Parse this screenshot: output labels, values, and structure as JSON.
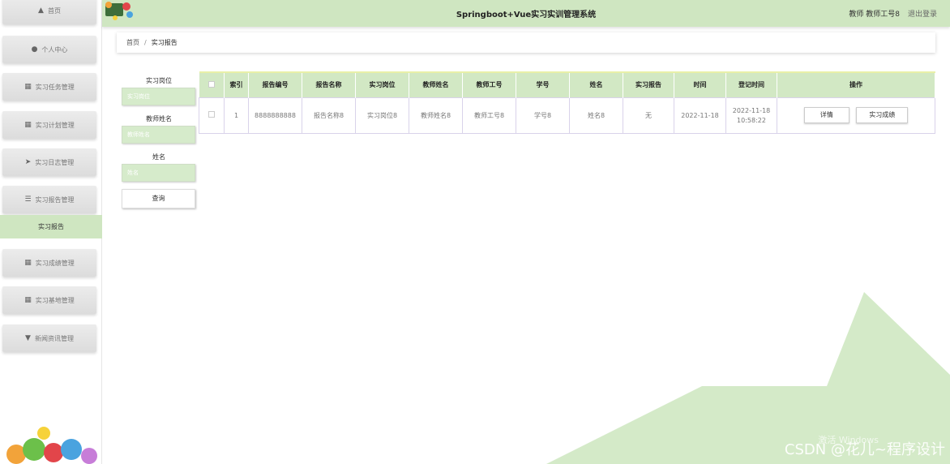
{
  "app": {
    "title": "Springboot+Vue实习实训管理系统",
    "user": "教师 教师工号8",
    "logout": "退出登录"
  },
  "sidebar": {
    "items": [
      {
        "label": "首页",
        "icon": "home-icon"
      },
      {
        "label": "个人中心",
        "icon": "person-icon"
      },
      {
        "label": "实习任务管理",
        "icon": "grid-icon"
      },
      {
        "label": "实习计划管理",
        "icon": "grid-icon"
      },
      {
        "label": "实习日志管理",
        "icon": "send-icon"
      },
      {
        "label": "实习报告管理",
        "icon": "list-icon"
      },
      {
        "label": "实习成绩管理",
        "icon": "grid-icon"
      },
      {
        "label": "实习基地管理",
        "icon": "grid-icon"
      },
      {
        "label": "新闻资讯管理",
        "icon": "news-icon"
      }
    ],
    "active_sub": "实习报告"
  },
  "breadcrumb": {
    "home": "首页",
    "sep": "/",
    "current": "实习报告"
  },
  "search": {
    "f1_label": "实习岗位",
    "f1_ph": "实习岗位",
    "f2_label": "教师姓名",
    "f2_ph": "教师姓名",
    "f3_label": "姓名",
    "f3_ph": "姓名",
    "btn": "查询"
  },
  "table": {
    "headers": [
      "索引",
      "报告编号",
      "报告名称",
      "实习岗位",
      "教师姓名",
      "教师工号",
      "学号",
      "姓名",
      "实习报告",
      "时间",
      "登记时间",
      "操作"
    ],
    "rows": [
      {
        "c": [
          "1",
          "8888888888",
          "报告名称8",
          "实习岗位8",
          "教师姓名8",
          "教师工号8",
          "学号8",
          "姓名8",
          "无",
          "2022-11-18"
        ],
        "reg_date": "2022-11-18",
        "reg_time": "10:58:22",
        "btn_detail": "详情",
        "btn_grade": "实习成绩"
      }
    ]
  },
  "watermark": {
    "text": "CSDN @花儿~程序设计",
    "win": "激活 Windows"
  },
  "colors": {
    "accent": "#cfe6c1",
    "header_top": "#e9f0a8"
  }
}
